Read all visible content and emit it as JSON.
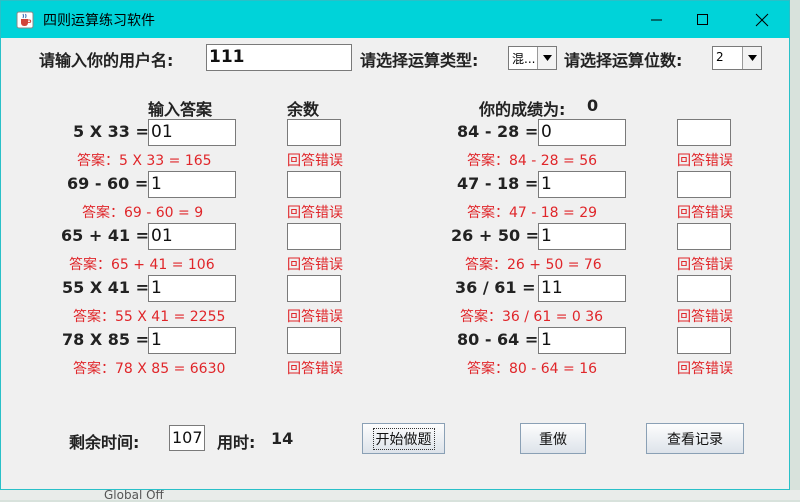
{
  "window": {
    "title": "四则运算练习软件"
  },
  "header": {
    "username_label": "请输入你的用户名:",
    "username_value": "111",
    "type_label": "请选择运算类型:",
    "type_value": "混...",
    "digits_label": "请选择运算位数:",
    "digits_value": "2"
  },
  "columns": {
    "answer_header": "输入答案",
    "remainder_header": "余数",
    "score_label": "你的成绩为:",
    "score_value": "0"
  },
  "left_rows": [
    {
      "expr": "5 X 33 =",
      "input": "01",
      "answer": "答案：5 X 33 = 165",
      "result": "回答错误"
    },
    {
      "expr": "69 - 60 =",
      "input": "1",
      "answer": "答案：69 - 60 = 9",
      "result": "回答错误"
    },
    {
      "expr": "65 + 41 =",
      "input": "01",
      "answer": "答案：65 + 41 = 106",
      "result": "回答错误"
    },
    {
      "expr": "55 X 41 =",
      "input": "1",
      "answer": "答案：55 X 41 = 2255",
      "result": "回答错误"
    },
    {
      "expr": "78 X 85 =",
      "input": "1",
      "answer": "答案：78 X 85 = 6630",
      "result": "回答错误"
    }
  ],
  "right_rows": [
    {
      "expr": "84 - 28 =",
      "input": "0",
      "answer": "答案：84 - 28 = 56",
      "result": "回答错误"
    },
    {
      "expr": "47 - 18 =",
      "input": "1",
      "answer": "答案：47 - 18 = 29",
      "result": "回答错误"
    },
    {
      "expr": "26 + 50 =",
      "input": "1",
      "answer": "答案：26 + 50 = 76",
      "result": "回答错误"
    },
    {
      "expr": "36 / 61 =",
      "input": "11",
      "answer": "答案：36 / 61 = 0 36",
      "result": "回答错误"
    },
    {
      "expr": "80 - 64 =",
      "input": "1",
      "answer": "答案：80 - 64 = 16",
      "result": "回答错误"
    }
  ],
  "footer": {
    "time_left_label": "剩余时间:",
    "time_left_value": "107",
    "time_used_label": "用时:",
    "time_used_value": "14",
    "start_button": "开始做题",
    "redo_button": "重做",
    "history_button": "查看记录"
  },
  "background": {
    "partial_text": "Global Off"
  },
  "colors": {
    "titlebar": "#00d3d9",
    "error": "#e0262a"
  },
  "icons": {
    "app": "java-cup-icon",
    "minimize": "minimize-icon",
    "maximize": "maximize-icon",
    "close": "close-icon"
  }
}
